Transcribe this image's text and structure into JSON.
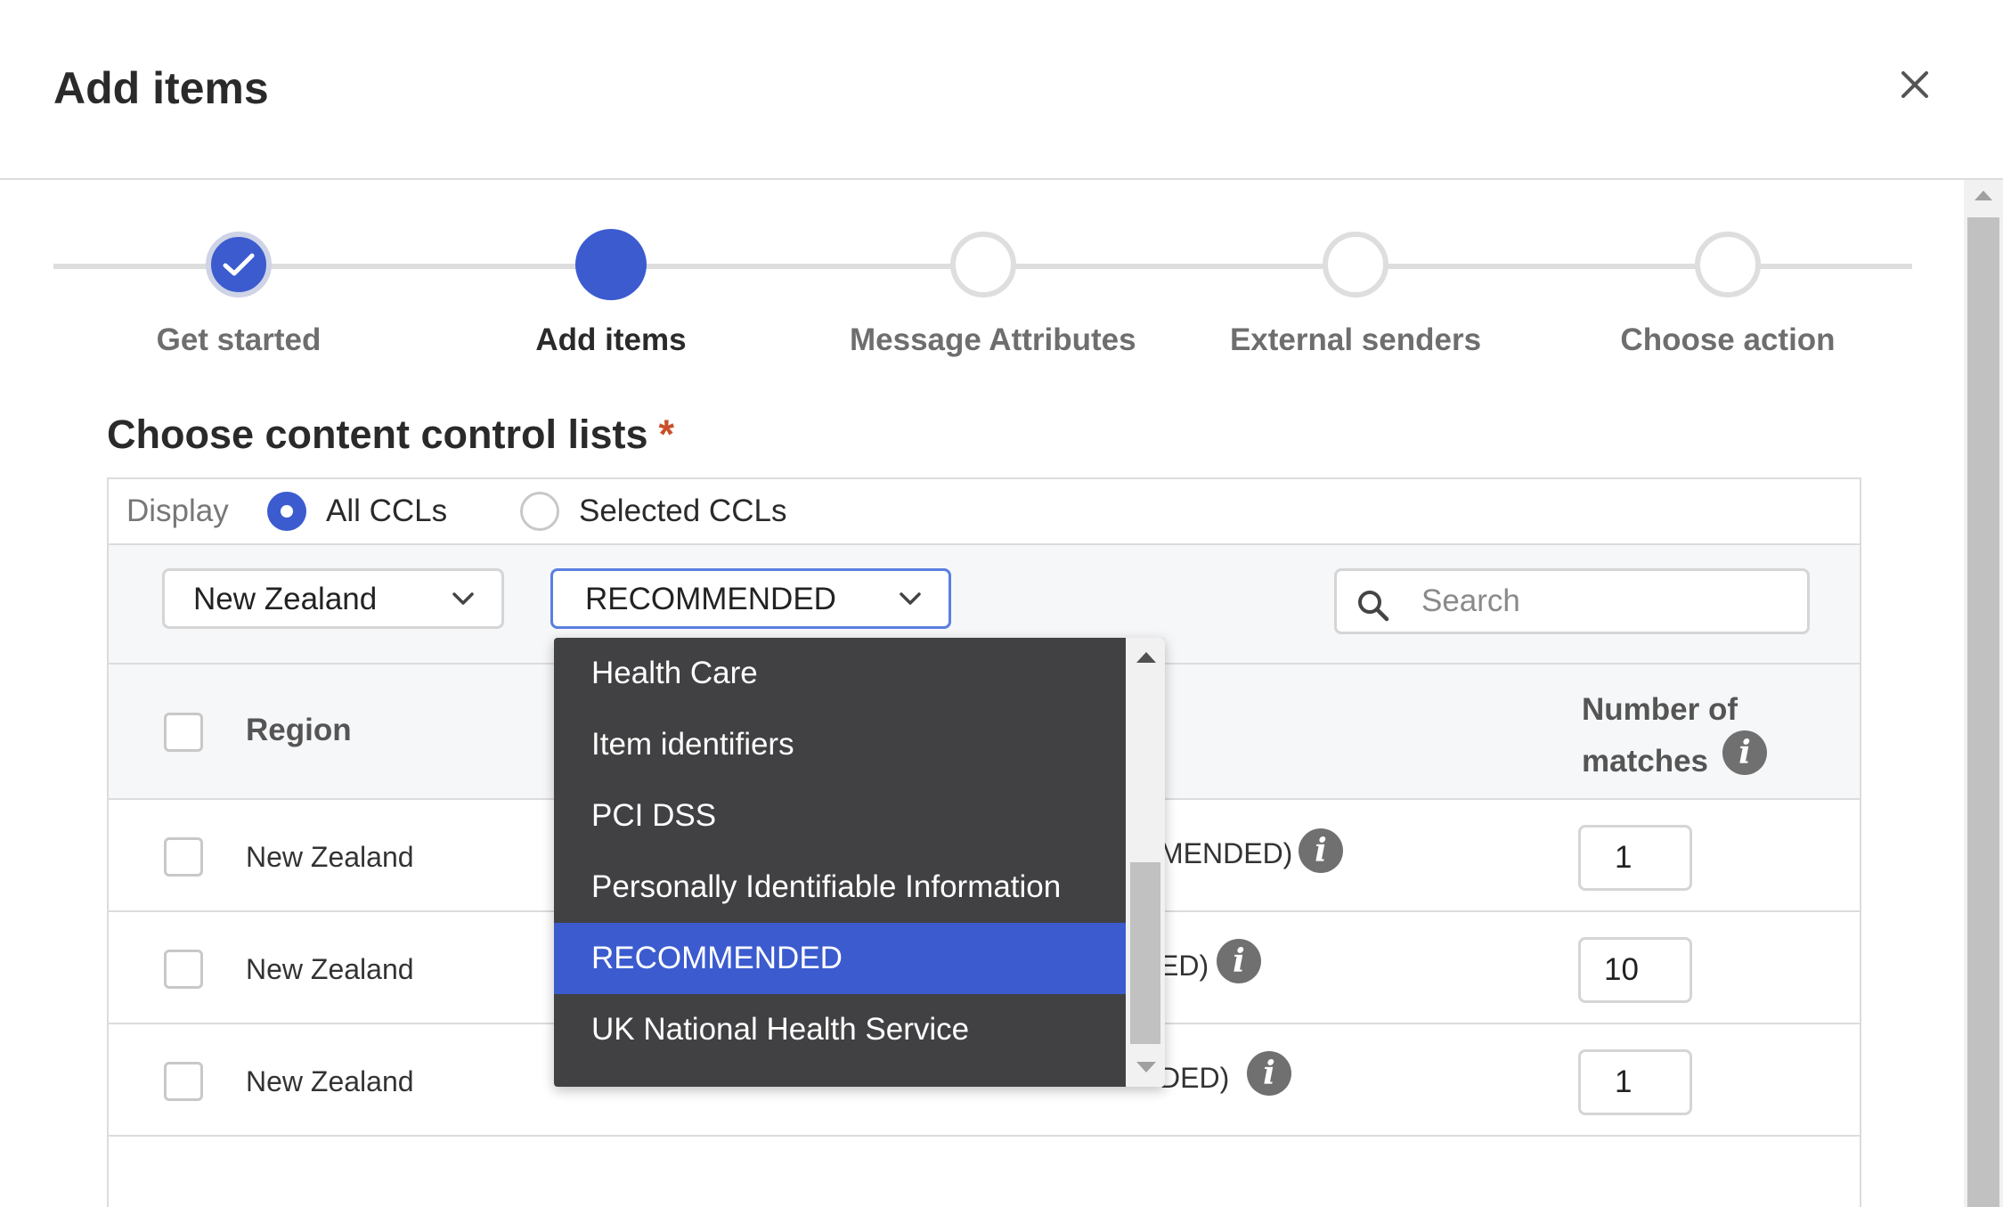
{
  "dialog": {
    "title": "Add items",
    "close_icon": "close-icon"
  },
  "stepper": {
    "steps": [
      {
        "label": "Get started",
        "state": "done"
      },
      {
        "label": "Add items",
        "state": "active"
      },
      {
        "label": "Message Attributes",
        "state": "todo"
      },
      {
        "label": "External senders",
        "state": "todo"
      },
      {
        "label": "Choose action",
        "state": "todo"
      }
    ]
  },
  "section": {
    "title": "Choose content control lists",
    "required_mark": "*"
  },
  "display": {
    "label": "Display",
    "options": [
      {
        "label": "All CCLs",
        "selected": true
      },
      {
        "label": "Selected CCLs",
        "selected": false
      }
    ]
  },
  "filters": {
    "region_select": "New Zealand",
    "category_select": "RECOMMENDED",
    "search_placeholder": "Search"
  },
  "table": {
    "headers": {
      "region": "Region",
      "matches": "Number of matches"
    },
    "rows": [
      {
        "region": "New Zealand",
        "name_visible": "MENDED)",
        "matches": "1"
      },
      {
        "region": "New Zealand",
        "name_visible": "ED)",
        "matches": "10"
      },
      {
        "region": "New Zealand",
        "name_visible": "DED)",
        "matches": "1"
      }
    ]
  },
  "dropdown": {
    "options": [
      "Health Care",
      "Item identifiers",
      "PCI DSS",
      "Personally Identifiable Information",
      "RECOMMENDED",
      "UK National Health Service"
    ],
    "selected_index": 4
  },
  "colors": {
    "accent": "#3b5bcf",
    "required": "#c9502b",
    "dropdown_bg": "#414143"
  }
}
